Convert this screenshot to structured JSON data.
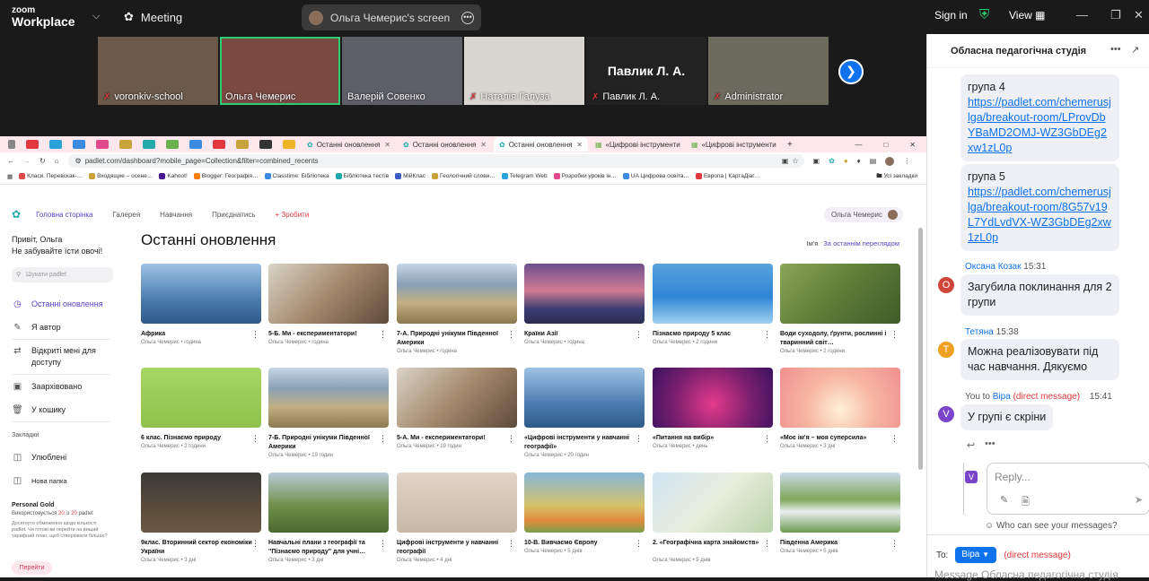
{
  "zoom": {
    "logo_line1": "zoom",
    "logo_line2": "Workplace",
    "meeting_label": "Meeting",
    "screen_share_label": "Ольга Чемерис's screen",
    "sign_in": "Sign in",
    "view": "View"
  },
  "participants": [
    {
      "name": "voronkiv-school",
      "bg": "#6b5a4a"
    },
    {
      "name": "Ольга Чемерис",
      "bg": "#7a4a42"
    },
    {
      "name": "Валерій Совенко",
      "bg": "#5d5e66"
    },
    {
      "name": "Наталія Галуза",
      "bg": "#d9d6d1"
    },
    {
      "name": "Павлик Л. А.",
      "bg": "#222222",
      "banner": "Павлик Л. А."
    },
    {
      "name": "Administrator",
      "bg": "#6d6a5e"
    }
  ],
  "browser": {
    "tabs": [
      "Останні оновлення",
      "Останні оновлення",
      "Останні оновлення",
      "«Цифрові інструменти",
      "«Цифрові інструменти"
    ],
    "url": "padlet.com/dashboard?mobile_page=Collection&filter=combined_recents",
    "bookmarks": [
      "Класи. Перевскак-…",
      "Входящие – осене…",
      "Kahoot!",
      "Blogger: Географія…",
      "Classtime: Бібліотека",
      "Бібліотека тестів",
      "МійКлас",
      "Геологічний словн…",
      "Telegram Web",
      "Розробки уроків ін…",
      "UA Цифрова освіта…",
      "Европа | КартаДіаг…",
      "Усі закладки"
    ]
  },
  "padlet": {
    "nav": {
      "home": "Головна сторінка",
      "gallery": "Галерея",
      "learn": "Навчання",
      "join": "Приєднатись",
      "make": "+ Зробити",
      "user": "Ольга Чемерис"
    },
    "greeting_1": "Привіт, Ольга",
    "greeting_2": "Не забувайте їсти овочі!",
    "search_placeholder": "Шукати padlet",
    "menu": {
      "recent": "Останні оновлення",
      "author": "Я автор",
      "shared_1": "Відкриті мені для",
      "shared_2": "доступу",
      "archived": "Заархівовано",
      "trash": "У кошику",
      "bookmarks_section": "Закладки",
      "favorites": "Улюблені",
      "new_folder": "Нова папка"
    },
    "gold": {
      "title": "Personal Gold",
      "usage_prefix": "Використовується",
      "used": "20",
      "usage_mid": "із",
      "limit": "20",
      "usage_suffix": "padlet",
      "desc": "Досягнуто обмеження щодо кількості padlet. Чи готові ви перейти на вищий тарифний план, щоб створювати більше?",
      "button": "Перейти"
    },
    "page_title": "Останні оновлення",
    "sort_label": "Ім'я",
    "sort_value": "За останнім переглядом",
    "cards": [
      {
        "title": "Африка",
        "meta": "Ольга Чемерис • година",
        "grad": "linear-gradient(#9fc3e4,#4b7cb0 60%,#2d5a88)"
      },
      {
        "title": "5-Б. Ми - експериментатори!",
        "meta": "Ольга Чемерис • година",
        "grad": "linear-gradient(135deg,#d9d3c7,#a4896c 50%,#5e4a3a)"
      },
      {
        "title": "7-А. Природні унікуми Південної Америки",
        "meta": "Ольга Чемерис • година",
        "grad": "linear-gradient(#c7d6e6 0%,#8aa0b6 35%,#c2b083 65%,#8c7a4e)"
      },
      {
        "title": "Країни Азії",
        "meta": "Ольга Чемерис • година",
        "grad": "linear-gradient(#6d4f8e,#d07b93 45%,#3b3f73 75%,#2a2d52)"
      },
      {
        "title": "Пізнаємо природу 5 клас",
        "meta": "Ольга Чемерис • 2 години",
        "grad": "linear-gradient(#5aa2de,#2e86d4 55%,#9fd0f2)"
      },
      {
        "title": "Води суходолу, ґрунти, рослинні і тваринний світ…",
        "meta": "Ольга Чемерис • 2 години",
        "grad": "linear-gradient(135deg,#8aa656,#5e7c36 50%,#3f5c2a)"
      },
      {
        "title": "6 клас. Пізнаємо природу",
        "meta": "Ольга Чемерис • 2 години",
        "grad": "linear-gradient(#a7d664,#8fc14a)"
      },
      {
        "title": "7-Б. Природні унікуми Південної Америки",
        "meta": "Ольга Чемерис • 19 годин",
        "grad": "linear-gradient(#c7d6e6 0%,#8aa0b6 35%,#c2b083 65%,#8c7a4e)"
      },
      {
        "title": "5-А. Ми - експериментатори!",
        "meta": "Ольга Чемерис • 19 годин",
        "grad": "linear-gradient(135deg,#d9d3c7,#a4896c 50%,#5e4a3a)"
      },
      {
        "title": "«Цифрові інструменти у навчанні географії»",
        "meta": "Ольга Чемерис • 20 годин",
        "grad": "linear-gradient(#9fc3e4,#4b7cb0 60%,#2d5a88)"
      },
      {
        "title": "«Питання на вибір»",
        "meta": "Ольга Чемерис • день",
        "grad": "radial-gradient(circle at 50% 60%,#e53a8a,#7a1f6e 55%,#3a1260)"
      },
      {
        "title": "«Моє ім'я – моя суперсила»",
        "meta": "Ольга Чемерис • 3 дні",
        "grad": "radial-gradient(circle at 50% 70%,#fff1d6,#f7b7a3 45%,#f08f8f)"
      },
      {
        "title": "9клас. Вторинний сектор економіки України",
        "meta": "Ольга Чемерис • 3 дні",
        "grad": "linear-gradient(#3b3a38,#5a4b3b 60%,#6e5a44)"
      },
      {
        "title": "Навчальні плани з географії та \"Пізнаємо природу\" для учні…",
        "meta": "Ольга Чемерис • 3 дні",
        "grad": "linear-gradient(#b8cbd8,#6f8f4a 55%,#4b6a2f)"
      },
      {
        "title": "Цифрові інструменти у навчанні географії",
        "meta": "Ольга Чемерис • 4 дні",
        "grad": "linear-gradient(#e0d5c7,#c7b8a6)"
      },
      {
        "title": "10-В. Вивчаємо Європу",
        "meta": "Ольга Чемерис • 5 днів",
        "grad": "linear-gradient(#86b6d8,#d6c36a 55%,#e08a3c 80%,#7aa04a)"
      },
      {
        "title": "2. «Географічна карта знайомств»",
        "meta": "Ольга Чемерис • 5 днів",
        "grad": "linear-gradient(135deg,#cfe4f2,#e8eedc 50%,#b8d2a8)"
      },
      {
        "title": "Південна Америка",
        "meta": "Ольга Чемерис • 5 днів",
        "grad": "linear-gradient(#c9d9e6,#7fa85a 45%,#e8eef0 65%,#6d9a52)"
      }
    ]
  },
  "chat": {
    "title": "Обласна педагогічна студія",
    "group4_label": "група 4",
    "group4_link": "https://padlet.com/chemerusjlga/breakout-room/LProvDbYBaMD2OMJ-WZ3GbDEg2xw1zL0p",
    "group5_label": "група 5",
    "group5_link": "https://padlet.com/chemerusjlga/breakout-room/8G57v19L7YdLvdVX-WZ3GbDEg2xw1zL0p",
    "m1_name": "Оксана Козак",
    "m1_time": "15:31",
    "m1_initial": "O",
    "m1_text": "Загубила поклинання для 2 групи",
    "m2_name": "Тетяна",
    "m2_time": "15:38",
    "m2_initial": "T",
    "m2_text": "Можна реалізовувати під час навчання. Дякуємо",
    "m3_prefix": "You to",
    "m3_name": "Віра",
    "m3_dm": "(direct message)",
    "m3_time": "15:41",
    "m3_initial": "V",
    "m3_text": "У групі є скріни",
    "reply_placeholder": "Reply...",
    "reply_initial": "V",
    "who_can_see": "Who can see your messages?",
    "to_label": "To:",
    "to_value": "Віра",
    "to_dm": "(direct message)",
    "message_placeholder": "Message Обласна педагогічна студія"
  }
}
